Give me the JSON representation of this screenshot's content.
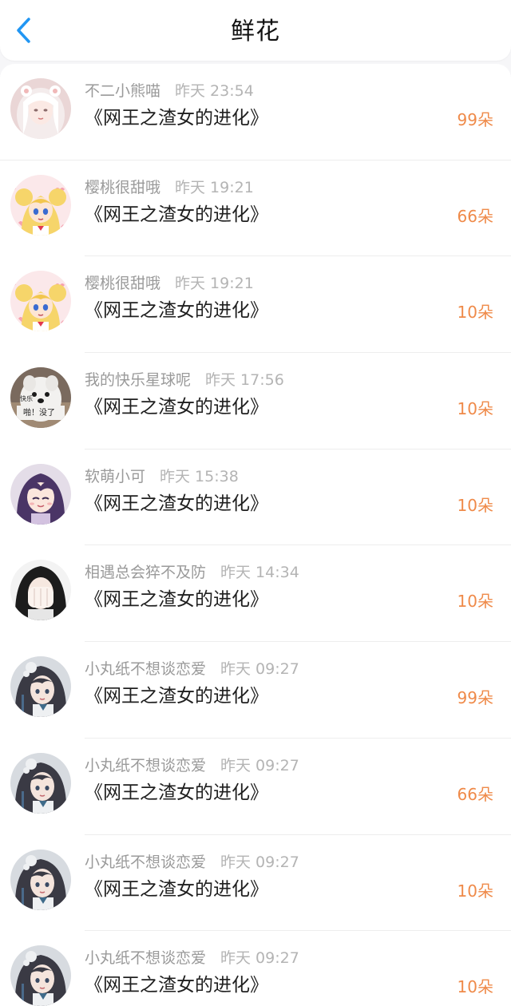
{
  "header": {
    "title": "鲜花",
    "accent": "#2196f3"
  },
  "colors": {
    "amount": "#ef8a49",
    "username": "#9a9a9a",
    "time": "#b4b4b4"
  },
  "rows": [
    {
      "user": "不二小熊喵",
      "time": "昨天 23:54",
      "book": "《网王之渣女的进化》",
      "amount": "99朵",
      "avatar": "white-hair-girl-avatar"
    },
    {
      "user": "樱桃很甜哦",
      "time": "昨天 19:21",
      "book": "《网王之渣女的进化》",
      "amount": "66朵",
      "avatar": "sailor-moon-avatar"
    },
    {
      "user": "樱桃很甜哦",
      "time": "昨天 19:21",
      "book": "《网王之渣女的进化》",
      "amount": "10朵",
      "avatar": "sailor-moon-avatar"
    },
    {
      "user": "我的快乐星球呢",
      "time": "昨天 17:56",
      "book": "《网王之渣女的进化》",
      "amount": "10朵",
      "avatar": "white-dog-meme-avatar",
      "avatar_text": [
        "快乐",
        "啪！没了"
      ]
    },
    {
      "user": "软萌小可",
      "time": "昨天 15:38",
      "book": "《网王之渣女的进化》",
      "amount": "10朵",
      "avatar": "purple-hair-anime-girl-avatar"
    },
    {
      "user": "相遇总会猝不及防",
      "time": "昨天 14:34",
      "book": "《网王之渣女的进化》",
      "amount": "10朵",
      "avatar": "hands-over-face-avatar"
    },
    {
      "user": "小丸纸不想谈恋爱",
      "time": "昨天 09:27",
      "book": "《网王之渣女的进化》",
      "amount": "99朵",
      "avatar": "dark-hair-anime-girl-avatar"
    },
    {
      "user": "小丸纸不想谈恋爱",
      "time": "昨天 09:27",
      "book": "《网王之渣女的进化》",
      "amount": "66朵",
      "avatar": "dark-hair-anime-girl-avatar"
    },
    {
      "user": "小丸纸不想谈恋爱",
      "time": "昨天 09:27",
      "book": "《网王之渣女的进化》",
      "amount": "10朵",
      "avatar": "dark-hair-anime-girl-avatar"
    },
    {
      "user": "小丸纸不想谈恋爱",
      "time": "昨天 09:27",
      "book": "《网王之渣女的进化》",
      "amount": "10朵",
      "avatar": "dark-hair-anime-girl-avatar"
    }
  ]
}
